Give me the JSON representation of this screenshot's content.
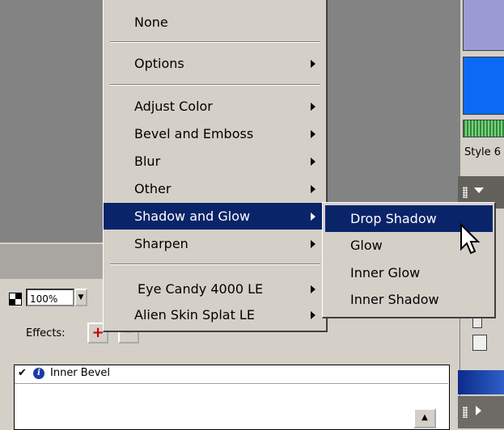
{
  "menu": {
    "items": [
      {
        "label": "None",
        "submenu": false
      },
      {
        "label": "Options",
        "submenu": true
      },
      {
        "label": "Adjust Color",
        "submenu": true
      },
      {
        "label": "Bevel and Emboss",
        "submenu": true
      },
      {
        "label": "Blur",
        "submenu": true
      },
      {
        "label": "Other",
        "submenu": true
      },
      {
        "label": "Shadow and Glow",
        "submenu": true,
        "highlighted": true
      },
      {
        "label": "Sharpen",
        "submenu": true
      },
      {
        "label": "Eye Candy 4000 LE",
        "submenu": true
      },
      {
        "label": "Alien Skin Splat LE",
        "submenu": true
      }
    ]
  },
  "submenu": {
    "items": [
      {
        "label": "Drop Shadow",
        "highlighted": true
      },
      {
        "label": "Glow"
      },
      {
        "label": "Inner Glow"
      },
      {
        "label": "Inner Shadow"
      }
    ]
  },
  "panel": {
    "zoom_value": "100%",
    "effects_label": "Effects:",
    "effects_list": [
      {
        "name": "Inner Bevel",
        "checked": true
      }
    ]
  },
  "styles": {
    "label": "Style 6"
  },
  "colors": {
    "highlight": "#0a246a",
    "swatch_lavender": "#9a9bd2",
    "swatch_blue": "#0a69f5",
    "canvas_gray": "#838383"
  }
}
